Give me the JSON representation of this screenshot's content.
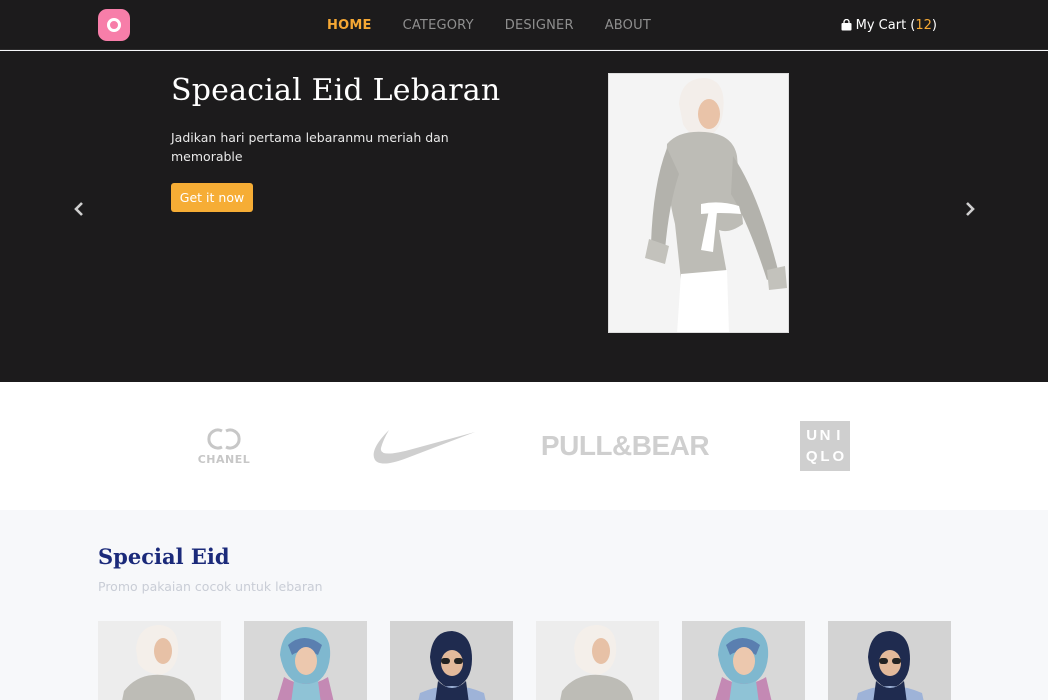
{
  "nav": {
    "links": [
      "HOME",
      "CATEGORY",
      "DESIGNER",
      "ABOUT"
    ],
    "active": "HOME",
    "cart_label": "My Cart (",
    "cart_count": "12",
    "cart_close": ")"
  },
  "hero": {
    "title": "Speacial Eid Lebaran",
    "description": "Jadikan hari pertama lebaranmu meriah dan memorable",
    "button": "Get it now"
  },
  "brands": {
    "chanel": "CHANEL",
    "pullbear": "PULL&BEAR",
    "uniqlo_letters": [
      "U",
      "N",
      "I",
      "Q",
      "L",
      "O"
    ]
  },
  "section": {
    "title": "Special Eid",
    "subtitle": "Promo pakaian cocok untuk lebaran"
  },
  "products": [
    {
      "variant": "grey-blouse"
    },
    {
      "variant": "pastel-scarf"
    },
    {
      "variant": "navy-hijab"
    },
    {
      "variant": "grey-blouse"
    },
    {
      "variant": "pastel-scarf"
    },
    {
      "variant": "navy-hijab"
    }
  ],
  "colors": {
    "accent": "#f6a834",
    "dark_bg": "#1c1b1c",
    "logo_pink": "#f77ea9",
    "section_title": "#1b2a7a"
  }
}
